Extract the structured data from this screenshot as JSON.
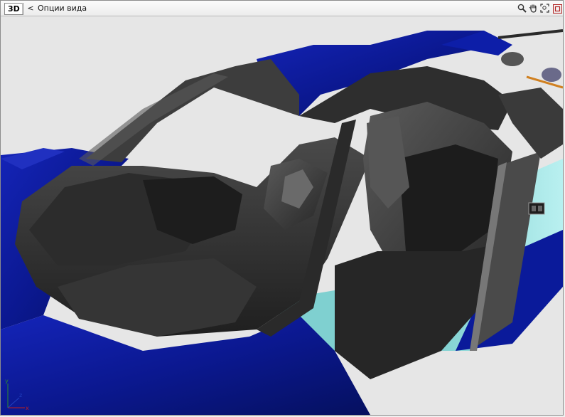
{
  "toolbar": {
    "view_mode": "3D",
    "back_label": "<",
    "title": "Опции вида"
  },
  "icons": {
    "zoom": "magnifier-icon",
    "pan": "hand-icon",
    "fit": "zoom-extents-icon",
    "close": "close-icon"
  },
  "viewport": {
    "background": "#e6e6e6",
    "model_colors": {
      "body": "#0a1a9a",
      "interior": "#3b3b3b",
      "glass": "#9fe3e3"
    }
  }
}
